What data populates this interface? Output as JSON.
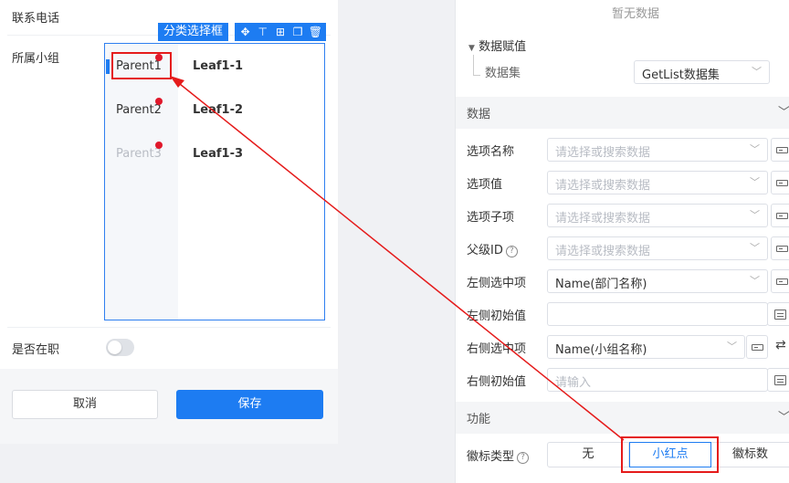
{
  "form": {
    "phone_label": "联系电话",
    "group_label": "所属小组",
    "employed_label": "是否在职",
    "component_tag": "分类选择框",
    "toolbar_icons": [
      "move-icon",
      "align-top-icon",
      "table-icon",
      "copy-icon",
      "delete-icon"
    ],
    "cascader": {
      "parents": [
        {
          "label": "Parent1",
          "disabled": false,
          "active": true
        },
        {
          "label": "Parent2",
          "disabled": false,
          "active": false
        },
        {
          "label": "Parent3",
          "disabled": true,
          "active": false
        }
      ],
      "leaves": [
        "Leaf1-1",
        "Leaf1-2",
        "Leaf1-3"
      ]
    },
    "employed_toggle": false,
    "cancel_label": "取消",
    "save_label": "保存"
  },
  "panel": {
    "no_data": "暂无数据",
    "data_assign": "数据赋值",
    "dataset_label": "数据集",
    "dataset_value": "GetList数据集",
    "data_section": "数据",
    "option_name_label": "选项名称",
    "option_value_label": "选项值",
    "option_child_label": "选项子项",
    "parent_id_label": "父级ID",
    "select_placeholder": "请选择或搜索数据",
    "left_selected_label": "左侧选中项",
    "left_selected_value": "Name(部门名称)",
    "left_initial_label": "左侧初始值",
    "right_selected_label": "右侧选中项",
    "right_selected_value": "Name(小组名称)",
    "right_initial_label": "右侧初始值",
    "input_placeholder": "请输入",
    "function_section": "功能",
    "badge_type_label": "徽标类型",
    "badge_options": [
      "无",
      "小红点",
      "徽标数"
    ],
    "badge_selected": "小红点"
  },
  "colors": {
    "accent": "#1d7cf2",
    "badge_dot": "#e0182b",
    "annotation": "#e51b1b"
  }
}
